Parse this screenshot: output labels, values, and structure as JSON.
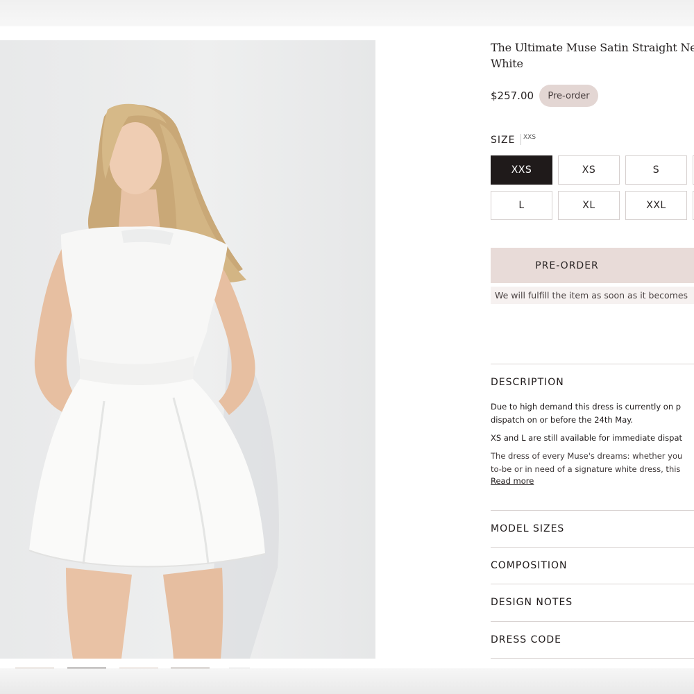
{
  "product": {
    "title_line1": "The Ultimate Muse Satin Straight Neck Mi",
    "title_line2": "White",
    "price": "$257.00",
    "badge": "Pre-order",
    "image_alt": "Model wearing a white satin straight neck mini dress"
  },
  "size": {
    "label": "SIZE",
    "selected": "XXS",
    "options": [
      "XXS",
      "XS",
      "S",
      "L",
      "XL",
      "XXL"
    ]
  },
  "actions": {
    "preorder_label": "PRE-ORDER",
    "notice": "We will fulfill the item as soon as it becomes"
  },
  "description": {
    "heading": "DESCRIPTION",
    "para1_line1": "Due to high demand this dress is currently on p",
    "para1_line2": "dispatch on or before the 24th May.",
    "para2": "XS and L are still available for immediate dispat",
    "para3_line1": "The dress of every Muse's dreams: whether you",
    "para3_line2": "to-be or in need of a signature white dress, this",
    "read_more": "Read more"
  },
  "accordions": [
    {
      "label": "MODEL SIZES"
    },
    {
      "label": "COMPOSITION"
    },
    {
      "label": "DESIGN NOTES"
    },
    {
      "label": "DRESS CODE"
    }
  ],
  "colors": {
    "selected_size_bg": "#1f1a1a",
    "preorder_bg": "#e8dbd8",
    "badge_bg": "#e3d6d3"
  }
}
